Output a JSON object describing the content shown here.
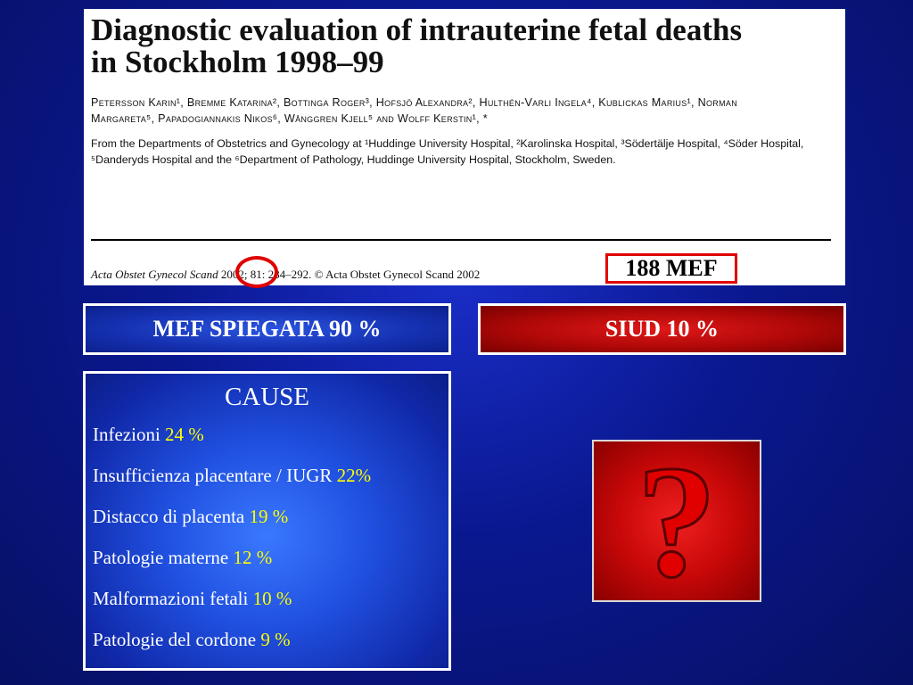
{
  "paper": {
    "title": "Diagnostic evaluation of intrauterine fetal deaths in Stockholm 1998–99",
    "authors": "Petersson Karin¹, Bremme Katarina², Bottinga Roger³, Hofsjö Alexandra², Hulthén-Varli Ingela⁴, Kublickas Marius¹, Norman Margareta⁵, Papadogiannakis Nikos⁶, Wånggren Kjell⁵ and Wolff Kerstin¹, *",
    "affiliations": "From the Departments of Obstetrics and Gynecology at ¹Huddinge University Hospital, ²Karolinska Hospital, ³Södertälje Hospital, ⁴Söder Hospital, ⁵Danderyds Hospital and the ⁶Department of Pathology, Huddinge University Hospital, Stockholm, Sweden.",
    "citation_journal": "Acta Obstet Gynecol Scand",
    "citation_rest": " 2002; 81: 284–292. © Acta Obstet Gynecol Scand 2002",
    "case_count": "188 MEF"
  },
  "headline": {
    "left": "MEF SPIEGATA 90 %",
    "right": "SIUD 10 %"
  },
  "causes": {
    "title": "CAUSE",
    "items": [
      {
        "label": "Infezioni ",
        "pct": "24 %"
      },
      {
        "label": "Insufficienza placentare / IUGR ",
        "pct": "22%"
      },
      {
        "label": "Distacco di placenta ",
        "pct": "19 %"
      },
      {
        "label": "Patologie materne ",
        "pct": "12 %"
      },
      {
        "label": "Malformazioni fetali ",
        "pct": "10 %"
      },
      {
        "label": "Patologie del cordone ",
        "pct": "9 %"
      }
    ]
  },
  "question_mark": {
    "glyph": "?",
    "icon": "question-mark-icon"
  },
  "colors": {
    "background": "#0a1890",
    "highlight": "#ffff00",
    "alert": "#e00000"
  }
}
